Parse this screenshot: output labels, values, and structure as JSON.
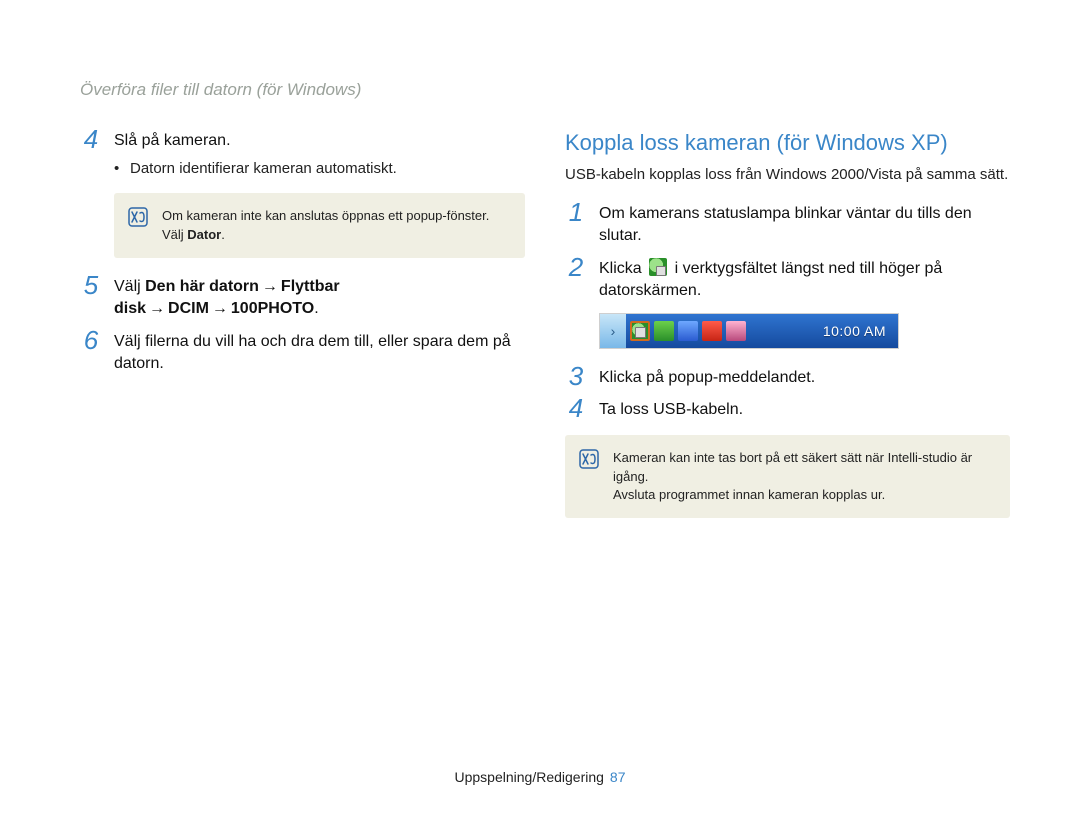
{
  "header": "Överföra filer till datorn (för Windows)",
  "left": {
    "steps": [
      {
        "num": "4",
        "text": "Slå på kameran.",
        "bullet": "Datorn identifierar kameran automatiskt.",
        "note": {
          "pre": "Om kameran inte kan anslutas öppnas ett popup-fönster. Välj ",
          "bold": "Dator",
          "post": "."
        }
      },
      {
        "num": "5",
        "pre": "Välj ",
        "path": [
          "Den här datorn",
          "Flyttbar disk",
          "DCIM",
          "100PHOTO"
        ],
        "post": "."
      },
      {
        "num": "6",
        "text": "Välj filerna du vill ha och dra dem till, eller spara dem på datorn."
      }
    ]
  },
  "right": {
    "title": "Koppla loss kameran (för Windows XP)",
    "sub": "USB-kabeln kopplas loss från Windows 2000/Vista på samma sätt.",
    "steps": [
      {
        "num": "1",
        "text": "Om kamerans statuslampa blinkar väntar du tills den slutar."
      },
      {
        "num": "2",
        "pre": "Klicka ",
        "post": " i verktygsfältet längst ned till höger på datorskärmen."
      },
      {
        "num": "3",
        "text": "Klicka på popup-meddelandet."
      },
      {
        "num": "4",
        "text": "Ta loss USB-kabeln."
      }
    ],
    "taskbar": {
      "clock": "10:00 AM"
    },
    "note": {
      "line1": "Kameran kan inte tas bort på ett säkert sätt när Intelli-studio är igång.",
      "line2": "Avsluta programmet innan kameran kopplas ur."
    }
  },
  "footer": {
    "section": "Uppspelning/Redigering",
    "page": "87"
  }
}
